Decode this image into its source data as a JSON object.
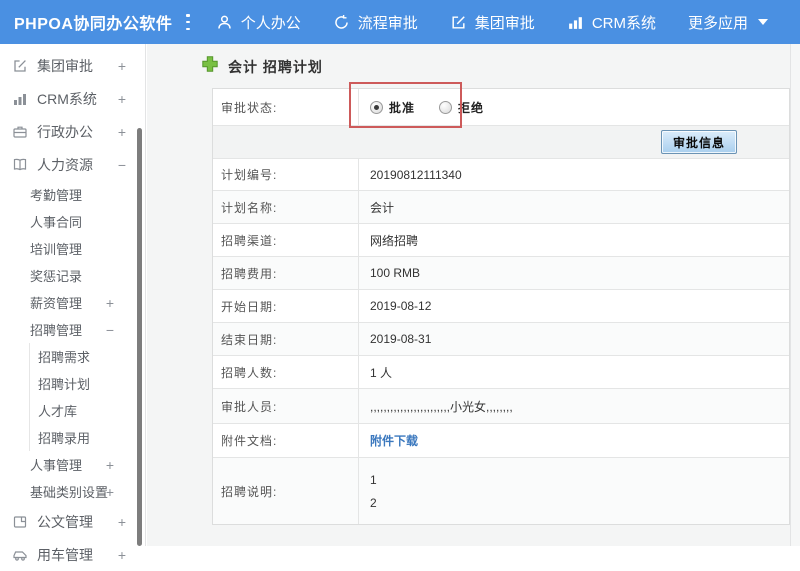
{
  "topbar": {
    "logo": "PHPOA协同办公软件",
    "menu": [
      {
        "label": "个人办公",
        "icon": "person-icon"
      },
      {
        "label": "流程审批",
        "icon": "process-icon"
      },
      {
        "label": "集团审批",
        "icon": "edit-square-icon"
      },
      {
        "label": "CRM系统",
        "icon": "bar-chart-icon"
      },
      {
        "label": "更多应用",
        "icon": "caret-down-icon"
      }
    ]
  },
  "sidebar": {
    "items": [
      {
        "label": "集团审批",
        "expand": "+",
        "icon": "edit-square-icon",
        "level": 1
      },
      {
        "label": "CRM系统",
        "expand": "+",
        "icon": "bar-chart-icon",
        "level": 1
      },
      {
        "label": "行政办公",
        "expand": "+",
        "icon": "briefcase-icon",
        "level": 1
      },
      {
        "label": "人力资源",
        "expand": "−",
        "icon": "book-icon",
        "level": 1
      },
      {
        "label": "考勤管理",
        "level": 2
      },
      {
        "label": "人事合同",
        "level": 2
      },
      {
        "label": "培训管理",
        "level": 2
      },
      {
        "label": "奖惩记录",
        "level": 2
      },
      {
        "label": "薪资管理",
        "expand": "+",
        "level": 2
      },
      {
        "label": "招聘管理",
        "expand": "−",
        "level": 2
      },
      {
        "label": "招聘需求",
        "level": 3
      },
      {
        "label": "招聘计划",
        "level": 3
      },
      {
        "label": "人才库",
        "level": 3
      },
      {
        "label": "招聘录用",
        "level": 3
      },
      {
        "label": "人事管理",
        "expand": "+",
        "level": 2
      },
      {
        "label": "基础类别设置",
        "expand": "+",
        "level": 2
      },
      {
        "label": "公文管理",
        "expand": "+",
        "icon": "document-icon",
        "level": 1
      },
      {
        "label": "用车管理",
        "expand": "+",
        "icon": "car-icon",
        "level": 1
      }
    ]
  },
  "main": {
    "title": "会计 招聘计划",
    "title_icon": "green-plus-icon",
    "approval": {
      "label": "审批状态:",
      "options": [
        {
          "label": "批准",
          "checked": true
        },
        {
          "label": "拒绝",
          "checked": false
        }
      ]
    },
    "annotation": {
      "shape": "rectangle",
      "color": "#cd5a5a",
      "highlights": "approval-status-radios"
    },
    "button_label": "审批信息",
    "rows": [
      {
        "label": "计划编号:",
        "value": "20190812111340"
      },
      {
        "label": "计划名称:",
        "value": "会计"
      },
      {
        "label": "招聘渠道:",
        "value": "网络招聘"
      },
      {
        "label": "招聘费用:",
        "value": "100 RMB"
      },
      {
        "label": "开始日期:",
        "value": "2019-08-12"
      },
      {
        "label": "结束日期:",
        "value": "2019-08-31"
      },
      {
        "label": "招聘人数:",
        "value": "1 人"
      },
      {
        "label": "审批人员:",
        "value": ",,,,,,,,,,,,,,,,,,,,,,,,小光女,,,,,,,,"
      },
      {
        "label": "附件文档:",
        "value": "附件下载",
        "type": "link"
      },
      {
        "label": "招聘说明:",
        "lines": [
          "1",
          "2"
        ]
      }
    ]
  },
  "colors": {
    "topbar": "#4a90e2",
    "link": "#3b78be",
    "annotation": "#cd5a5a",
    "button_face": "#a9cfee"
  }
}
